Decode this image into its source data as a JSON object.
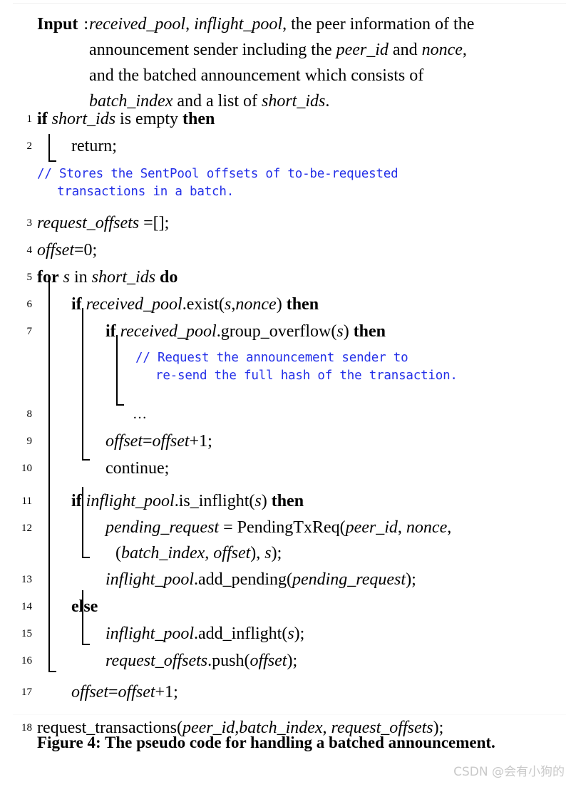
{
  "document": {
    "kind": "algorithm-pseudocode-figure"
  },
  "input_header": {
    "label": "Input",
    "colon": ":",
    "text": "received_pool, inflight_pool, the peer information of the announcement sender including the peer_id and nonce, and the batched announcement which consists of batch_index and a list of short_ids."
  },
  "lines": [
    {
      "no": "1",
      "text": "if short_ids is empty then"
    },
    {
      "no": "2",
      "text": "return;"
    },
    {
      "no": "",
      "text": "// Stores the SentPool offsets of to-be-requested transactions in a batch."
    },
    {
      "no": "3",
      "text": "request_offsets =[];"
    },
    {
      "no": "4",
      "text": "offset=0;"
    },
    {
      "no": "5",
      "text": "for s in short_ids do"
    },
    {
      "no": "6",
      "text": "if received_pool.exist(s,nonce) then"
    },
    {
      "no": "7",
      "text": "if received_pool.group_overflow(s) then"
    },
    {
      "no": "",
      "text": "// Request the announcement sender to re-send the full hash of the transaction."
    },
    {
      "no": "8",
      "text": "..."
    },
    {
      "no": "9",
      "text": "offset=offset+1;"
    },
    {
      "no": "10",
      "text": "continue;"
    },
    {
      "no": "11",
      "text": "if inflight_pool.is_inflight(s) then"
    },
    {
      "no": "12",
      "text": "pending_request = PendingTxReq(peer_id, nonce, (batch_index, offset), s);"
    },
    {
      "no": "13",
      "text": "inflight_pool.add_pending(pending_request);"
    },
    {
      "no": "14",
      "text": "else"
    },
    {
      "no": "15",
      "text": "inflight_pool.add_inflight(s);"
    },
    {
      "no": "16",
      "text": "request_offsets.push(offset);"
    },
    {
      "no": "17",
      "text": "offset=offset+1;"
    },
    {
      "no": "18",
      "text": "request_transactions(peer_id,batch_index, request_offsets);"
    }
  ],
  "comments": {
    "c1_line1": "// Stores the SentPool offsets of to-be-requested",
    "c1_line2": "transactions in a batch.",
    "c2_line1": "// Request the announcement sender to",
    "c2_line2": "re-send the full hash of the transaction."
  },
  "tokens": {
    "kw_if": "if",
    "kw_then": "then",
    "kw_for": "for",
    "kw_do": "do",
    "kw_else": "else",
    "kw_in": "in",
    "kw_is_empty": "is empty",
    "return": "return;",
    "continue": "continue;",
    "ellipsis": "…",
    "received_pool": "received_pool",
    "inflight_pool": "inflight_pool",
    "short_ids": "short_ids",
    "request_offsets": "request_offsets",
    "offset": "offset",
    "nonce": "nonce",
    "peer_id": "peer_id",
    "batch_index": "batch_index",
    "pending_request": "pending_request",
    "s": "s",
    "assign_empty": " =[];",
    "offset_zero": "=0;",
    "offset_incr": "=offset+1;",
    "exist_call": ".exist(",
    "group_overflow_call": ".group_overflow(",
    "is_inflight_call": ".is_inflight(",
    "add_pending_call": ".add_pending(",
    "add_inflight_call": ".add_inflight(",
    "push_call": ".push(",
    "pendingtxreq": "PendingTxReq(",
    "request_transactions": "request_transactions(",
    "eq": " = "
  },
  "caption": {
    "text": "Figure 4: The pseudo code for handling a batched announcement."
  },
  "watermark": {
    "text": "CSDN @会有小狗的"
  },
  "colors": {
    "comment_blue": "#2430e8",
    "text_black": "#000000",
    "watermark_gray": "#c9c9c9"
  }
}
